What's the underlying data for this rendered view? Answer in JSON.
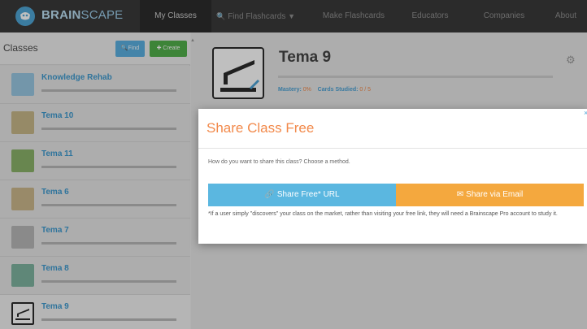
{
  "brand": {
    "name_bold": "BRAIN",
    "name_light": "SCAPE",
    "accent": "#4fa6d6"
  },
  "nav": {
    "items": [
      {
        "label": "My Classes"
      },
      {
        "label": "Find Flashcards",
        "icon": "search-icon",
        "caret": "▼"
      },
      {
        "label": "Make Flashcards"
      },
      {
        "label": "Educators"
      },
      {
        "label": "Companies"
      },
      {
        "label": "About"
      }
    ]
  },
  "sidebar": {
    "title": "Classes",
    "find_label": "Find",
    "create_label": "Create",
    "items": [
      {
        "name": "Knowledge Rehab",
        "thumb_color": "#9ac9e3"
      },
      {
        "name": "Tema 10",
        "thumb_color": "#c9b98a"
      },
      {
        "name": "Tema 11",
        "thumb_color": "#8bb36a"
      },
      {
        "name": "Tema 6",
        "thumb_color": "#cdb98c"
      },
      {
        "name": "Tema 7",
        "thumb_color": "#b8b8b8"
      },
      {
        "name": "Tema 8",
        "thumb_color": "#7fb5a0"
      },
      {
        "name": "Tema 9",
        "thumb_color": "#ffffff"
      }
    ]
  },
  "deck": {
    "title": "Tema 9",
    "mastery_label": "Mastery:",
    "mastery_value": "0%",
    "cards_label": "Cards Studied:",
    "cards_value": "0 / 5"
  },
  "modal": {
    "title": "Share Class Free",
    "question": "How do you want to share this class? Choose a method.",
    "url_button": "Share Free* URL",
    "email_button": "Share via Email",
    "note": "*If a user simply \"discovers\" your class on the market, rather than visiting your free link, they will need a Brainscape Pro account to study it.",
    "colors": {
      "title": "#f2894a",
      "url_button": "#5bb7e0",
      "email_button": "#f4a83e"
    }
  }
}
